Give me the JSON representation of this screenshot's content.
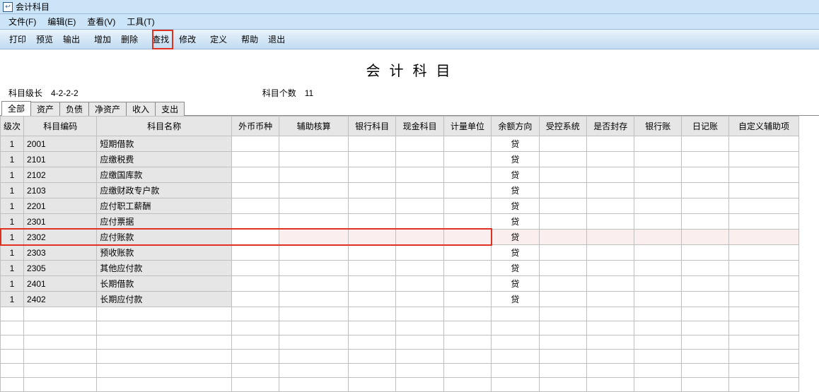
{
  "window": {
    "title": "会计科目"
  },
  "menu": {
    "file": "文件(F)",
    "edit": "编辑(E)",
    "view": "查看(V)",
    "tools": "工具(T)"
  },
  "toolbar": {
    "print": "打印",
    "preview": "预览",
    "output": "输出",
    "add": "增加",
    "delete": "删除",
    "find": "查找",
    "modify": "修改",
    "define": "定义",
    "help": "帮助",
    "exit": "退出"
  },
  "heading": "会 计 科 目",
  "info": {
    "level_label": "科目级长",
    "level_value": "4-2-2-2",
    "count_label": "科目个数",
    "count_value": "11"
  },
  "tabs": [
    "全部",
    "资产",
    "负债",
    "净资产",
    "收入",
    "支出"
  ],
  "columns": {
    "lvl": "级次",
    "code": "科目编码",
    "name": "科目名称",
    "curr": "外币币种",
    "aux": "辅助核算",
    "bank": "银行科目",
    "cash": "现金科目",
    "unit": "计量单位",
    "dir": "余额方向",
    "ctrl": "受控系统",
    "seal": "是否封存",
    "bankl": "银行账",
    "jrnl": "日记账",
    "cust": "自定义辅助项"
  },
  "rows": [
    {
      "lvl": "1",
      "code": "2001",
      "name": "短期借款",
      "dir": "贷"
    },
    {
      "lvl": "1",
      "code": "2101",
      "name": "应缴税费",
      "dir": "贷"
    },
    {
      "lvl": "1",
      "code": "2102",
      "name": "应缴国库款",
      "dir": "贷"
    },
    {
      "lvl": "1",
      "code": "2103",
      "name": "应缴财政专户款",
      "dir": "贷"
    },
    {
      "lvl": "1",
      "code": "2201",
      "name": "应付职工薪酬",
      "dir": "贷"
    },
    {
      "lvl": "1",
      "code": "2301",
      "name": "应付票据",
      "dir": "贷"
    },
    {
      "lvl": "1",
      "code": "2302",
      "name": "应付账款",
      "dir": "贷",
      "selected": true
    },
    {
      "lvl": "1",
      "code": "2303",
      "name": "预收账款",
      "dir": "贷"
    },
    {
      "lvl": "1",
      "code": "2305",
      "name": "其他应付款",
      "dir": "贷"
    },
    {
      "lvl": "1",
      "code": "2401",
      "name": "长期借款",
      "dir": "贷"
    },
    {
      "lvl": "1",
      "code": "2402",
      "name": "长期应付款",
      "dir": "贷"
    }
  ]
}
